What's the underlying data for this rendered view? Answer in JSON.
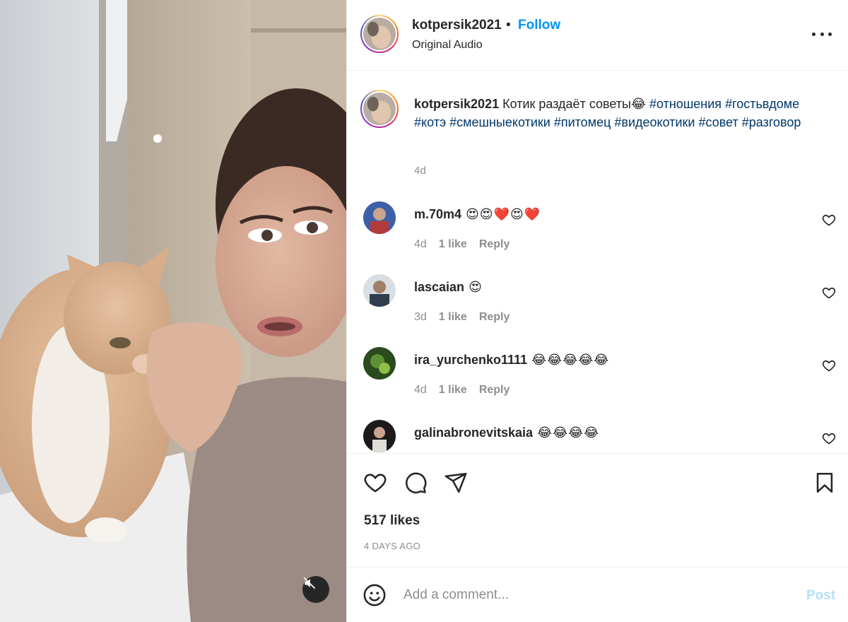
{
  "post": {
    "username": "kotpersik2021",
    "separator": "•",
    "follow_label": "Follow",
    "audio_label": "Original Audio",
    "more_icon": "more-horizontal-icon"
  },
  "caption": {
    "username": "kotpersik2021",
    "text": "Котик раздаёт советы😂",
    "hashtags": [
      "#отношения",
      "#гостьвдоме",
      "#котэ",
      "#смешныекотики",
      "#питомец",
      "#видеокотики",
      "#совет",
      "#разговор"
    ],
    "time": "4d"
  },
  "comments": [
    {
      "username": "m.70m4",
      "text": "😍😍❤️😍❤️",
      "time": "4d",
      "likes": "1 like",
      "reply": "Reply"
    },
    {
      "username": "lascaian",
      "text": "😍",
      "time": "3d",
      "likes": "1 like",
      "reply": "Reply"
    },
    {
      "username": "ira_yurchenko1111",
      "text": "😂😂😂😂😂",
      "time": "4d",
      "likes": "1 like",
      "reply": "Reply"
    },
    {
      "username": "galinabronevitskaia",
      "text": "😂😂😂😂",
      "time": "",
      "likes": "",
      "reply": ""
    }
  ],
  "actions": {
    "likes": "517 likes",
    "posted_ago": "4 DAYS AGO"
  },
  "add_comment": {
    "placeholder": "Add a comment...",
    "post_label": "Post"
  },
  "colors": {
    "link_blue": "#0095f6",
    "hashtag": "#00376b",
    "muted": "#8e8e8e",
    "post_disabled": "#b2dffc"
  }
}
